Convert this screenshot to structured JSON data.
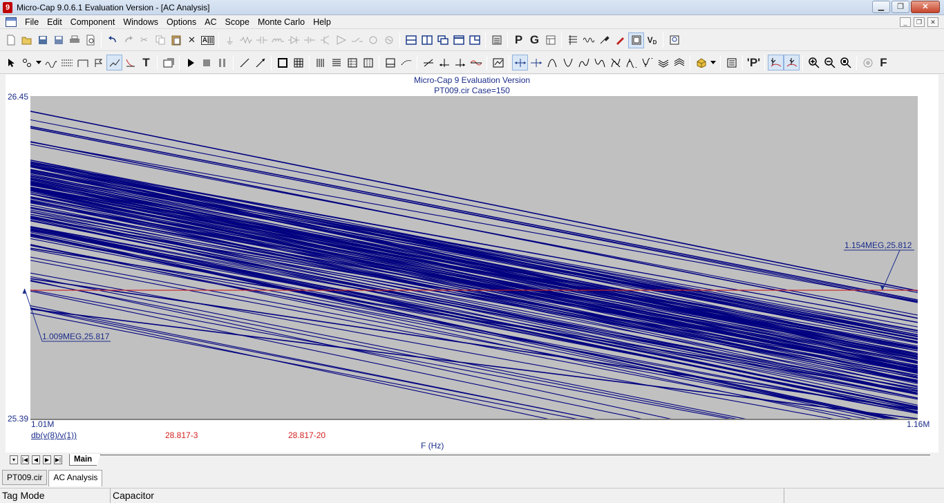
{
  "window": {
    "title": "Micro-Cap 9.0.6.1 Evaluation Version - [AC Analysis]",
    "app_icon": "9",
    "controls": {
      "minimize": "▁",
      "maximize": "❐",
      "close": "✕"
    }
  },
  "menu": {
    "items": [
      "File",
      "Edit",
      "Component",
      "Windows",
      "Options",
      "AC",
      "Scope",
      "Monte Carlo",
      "Help"
    ],
    "mdi_controls": {
      "minimize": "_",
      "restore": "❐",
      "close": "✕"
    }
  },
  "toolbar1": {
    "icons": [
      "new-icon",
      "open-icon",
      "save-icon",
      "save-all-icon",
      "print-icon",
      "print-preview-icon",
      "undo-icon",
      "redo-icon",
      "cut-icon",
      "copy-icon",
      "paste-icon",
      "delete-icon",
      "text-mode-icon",
      "ground-icon",
      "resistor-icon",
      "capacitor-icon",
      "inductor-icon",
      "diode-icon",
      "battery-icon",
      "transistor-icon",
      "opamp-icon",
      "switch-icon",
      "source-icon",
      "sine-source-icon",
      "view-top-icon",
      "view-tile-v-icon",
      "view-cascade-icon",
      "view-window-icon",
      "view-split-icon",
      "calculator-icon",
      "p-icon",
      "g-icon",
      "grid-icon",
      "component-list-icon",
      "waveform-icon",
      "probe-icon",
      "pen-icon",
      "sheet-icon",
      "vd-icon",
      "info-icon"
    ],
    "labels": {
      "text_mode": "A|||",
      "p": "P",
      "g": "G",
      "vd": "V",
      "vd_sub": "D"
    }
  },
  "toolbar2": {
    "icons": [
      "select-arrow-icon",
      "select-component-icon",
      "wire-icon",
      "bus-icon",
      "diagonal-wire-icon",
      "flag-icon",
      "info-icon",
      "text-icon",
      "tag-icon",
      "run-icon",
      "stop-icon",
      "pause-icon",
      "line-icon",
      "diagonal-line-icon",
      "box-icon",
      "grid-box-icon",
      "vertical-lines-icon",
      "horizontal-lines-icon",
      "table-icon",
      "table-alt-icon",
      "horizontal-marker-icon",
      "dashed-marker-icon",
      "slope-icon",
      "cursor-left-icon",
      "cursor-right-icon",
      "tag-marker-icon",
      "go-to-x-icon",
      "next-point-icon",
      "next-point-left-icon",
      "peak-icon",
      "valley-icon",
      "high-icon",
      "low-icon",
      "inflection-icon",
      "global-high-icon",
      "global-low-icon",
      "top-icon",
      "bottom-icon",
      "properties-icon",
      "data-icon",
      "page-icon",
      "label-icon",
      "point-tag-icon",
      "horizontal-tag-icon",
      "zoom-in-icon",
      "zoom-out-icon",
      "zoom-fit-icon",
      "lock-icon",
      "f-icon"
    ],
    "labels": {
      "text": "T",
      "tag": "'P'",
      "f": "F"
    }
  },
  "plot": {
    "header_line1": "Micro-Cap 9 Evaluation Version",
    "header_line2": "PT009.cir Case=150",
    "y_top": "26.45",
    "y_bottom": "25.39",
    "x_left": "1.01M",
    "x_right": "1.16M",
    "expression": "db(v(8)/v(1))",
    "cursor_left_value": "28.817-3",
    "cursor_right_value": "28.817-20",
    "x_axis_label": "F (Hz)",
    "tag_left": "1.009MEG,25.817",
    "tag_right": "1.154MEG,25.812",
    "colors": {
      "background": "#c0c0c0",
      "curve": "#000080",
      "marker_line": "#d02020",
      "text": "#1a2c8a"
    }
  },
  "chart_data": {
    "type": "line",
    "title": "Micro-Cap 9 Evaluation Version",
    "subtitle": "PT009.cir Case=150",
    "xlabel": "F (Hz)",
    "ylabel": "db(v(8)/v(1))",
    "xlim": [
      1010000,
      1160000
    ],
    "ylim": [
      25.39,
      26.45
    ],
    "series_count_shown": 150,
    "series_sample": [
      {
        "x": [
          1010000,
          1160000
        ],
        "y": [
          26.4,
          25.81
        ]
      },
      {
        "x": [
          1010000,
          1160000
        ],
        "y": [
          26.35,
          25.78
        ]
      },
      {
        "x": [
          1010000,
          1160000
        ],
        "y": [
          26.3,
          25.72
        ]
      },
      {
        "x": [
          1010000,
          1160000
        ],
        "y": [
          26.22,
          25.66
        ]
      },
      {
        "x": [
          1010000,
          1160000
        ],
        "y": [
          26.15,
          25.6
        ]
      },
      {
        "x": [
          1010000,
          1160000
        ],
        "y": [
          26.05,
          25.55
        ]
      },
      {
        "x": [
          1010000,
          1160000
        ],
        "y": [
          25.95,
          25.48
        ]
      },
      {
        "x": [
          1010000,
          1160000
        ],
        "y": [
          25.85,
          25.42
        ]
      },
      {
        "x": [
          1010000,
          1160000
        ],
        "y": [
          25.75,
          25.39
        ]
      }
    ],
    "marker_y": 25.812,
    "tags": [
      {
        "x": 1009000,
        "y": 25.817,
        "label": "1.009MEG,25.817"
      },
      {
        "x": 1154000,
        "y": 25.812,
        "label": "1.154MEG,25.812"
      }
    ]
  },
  "page_tabs": {
    "main": "Main",
    "nav": [
      "▾",
      "|◀",
      "◀",
      "▶",
      "▶|"
    ]
  },
  "doc_tabs": [
    "PT009.cir",
    "AC Analysis"
  ],
  "status": {
    "mode": "Tag Mode",
    "component": "Capacitor",
    "extra": ""
  }
}
